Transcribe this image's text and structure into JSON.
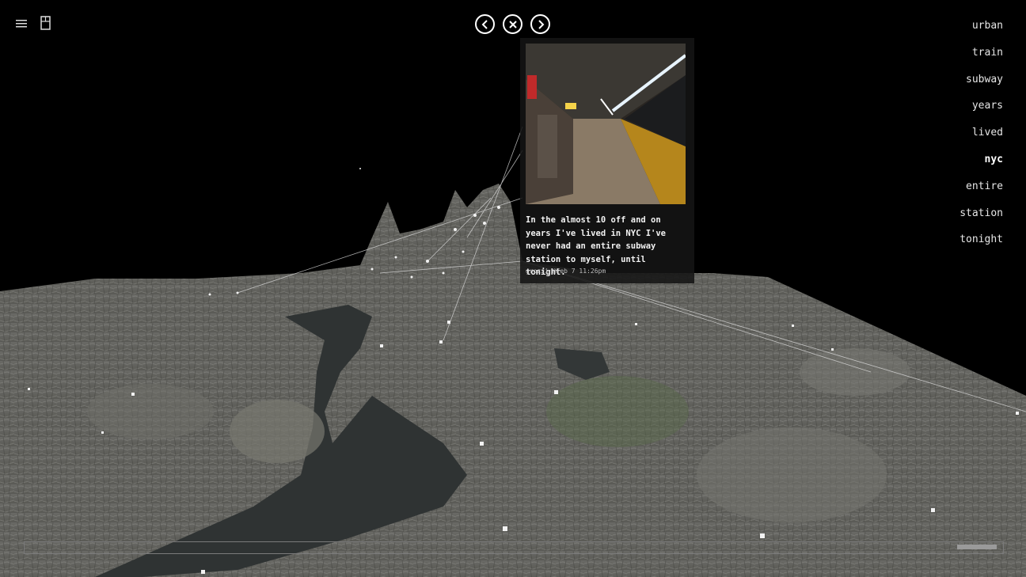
{
  "nav": {
    "menu_icon": "menu-icon",
    "guide_icon": "book-icon",
    "prev_icon": "chevron-left-icon",
    "close_icon": "close-icon",
    "next_icon": "chevron-right-icon"
  },
  "keywords": [
    "urban",
    "train",
    "subway",
    "years",
    "lived",
    "nyc",
    "entire",
    "station",
    "tonight"
  ],
  "active_keyword": "nyc",
  "post": {
    "text": "In the almost 10 off and on years I've lived in NYC I've never had an entire subway station to myself, until tonight.",
    "meta": "grozzi @Feb 7 11:26pm"
  },
  "colors": {
    "background": "#000000",
    "terrain": "#6b6b66",
    "water": "#2f3333",
    "text": "#ffffff"
  }
}
